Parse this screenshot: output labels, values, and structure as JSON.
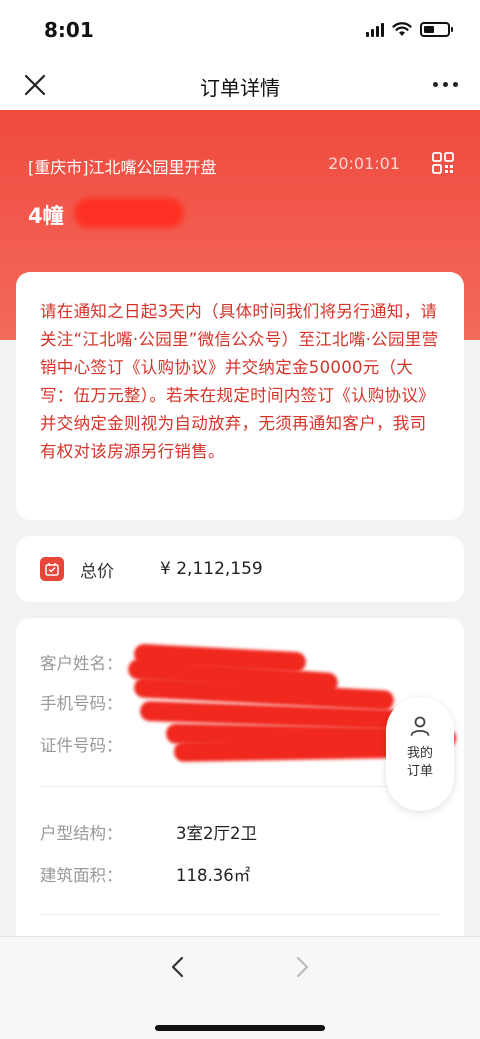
{
  "status_bar": {
    "time": "8:01"
  },
  "nav": {
    "title": "订单详情"
  },
  "hero": {
    "project_name": "[重庆市]江北嘴公园里开盘",
    "time": "20:01:01",
    "unit": "4幢"
  },
  "notice": {
    "text": "请在通知之日起3天内（具体时间我们将另行通知，请关注“江北嘴·公园里”微信公众号）至江北嘴·公园里营销中心签订《认购协议》并交纳定金50000元（大写：伍万元整）。若未在规定时间内签订《认购协议》并交纳定金则视为自动放弃，无须再通知客户，我司有权对该房源另行销售。"
  },
  "price": {
    "label": "总价",
    "value": "¥ 2,112,159"
  },
  "customer": {
    "name_label": "客户姓名：",
    "phone_label": "手机号码：",
    "id_label": "证件号码："
  },
  "unit_info": {
    "layout_label": "户型结构：",
    "layout_value": "3室2厅2卫",
    "area_label": "建筑面积：",
    "area_value": "118.36㎡"
  },
  "floating": {
    "my_orders": "我的订单"
  },
  "colors": {
    "accent": "#f04a3f",
    "notice_text": "#d63329"
  }
}
